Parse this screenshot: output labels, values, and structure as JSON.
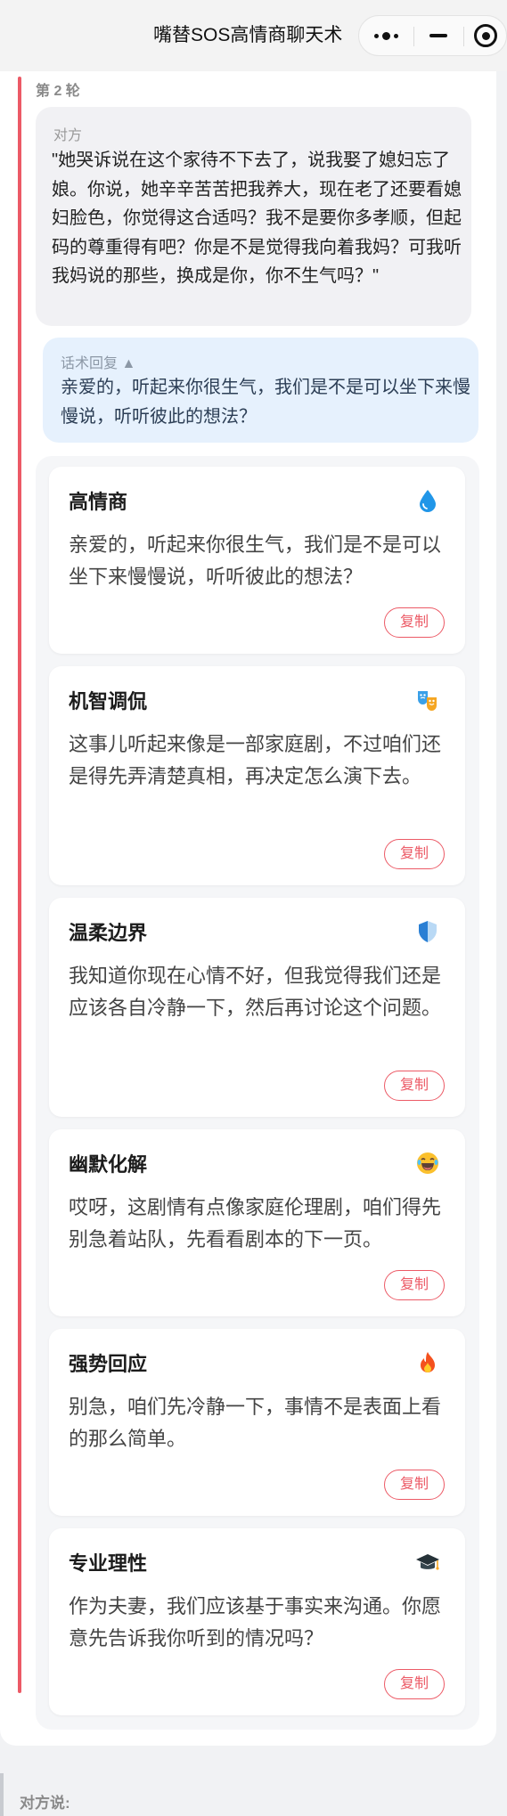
{
  "header": {
    "title": "嘴替SOS高情商聊天术"
  },
  "round": {
    "label": "第 2 轮",
    "opponent": {
      "label": "对方",
      "text": "\"她哭诉说在这个家待不下去了，说我娶了媳妇忘了娘。你说，她辛辛苦苦把我养大，现在老了还要看媳妇脸色，你觉得这合适吗？我不是要你多孝顺，但起码的尊重得有吧？你是不是觉得我向着我妈？可我听我妈说的那些，换成是你，你不生气吗？\""
    },
    "reply": {
      "label": "话术回复 ▲",
      "text": "亲爱的，听起来你很生气，我们是不是可以坐下来慢慢说，听听彼此的想法？"
    },
    "options": [
      {
        "title": "高情商",
        "icon": "droplet-icon",
        "text": "亲爱的，听起来你很生气，我们是不是可以坐下来慢慢说，听听彼此的想法？",
        "copy_label": "复制"
      },
      {
        "title": "机智调侃",
        "icon": "theater-masks-icon",
        "text": "这事儿听起来像是一部家庭剧，不过咱们还是得先弄清楚真相，再决定怎么演下去。",
        "copy_label": "复制"
      },
      {
        "title": "温柔边界",
        "icon": "shield-icon",
        "text": "我知道你现在心情不好，但我觉得我们还是应该各自冷静一下，然后再讨论这个问题。",
        "copy_label": "复制"
      },
      {
        "title": "幽默化解",
        "icon": "laughing-emoji-icon",
        "text": "哎呀，这剧情有点像家庭伦理剧，咱们得先别急着站队，先看看剧本的下一页。",
        "copy_label": "复制"
      },
      {
        "title": "强势回应",
        "icon": "fire-icon",
        "text": "别急，咱们先冷静一下，事情不是表面上看的那么简单。",
        "copy_label": "复制"
      },
      {
        "title": "专业理性",
        "icon": "graduation-cap-icon",
        "text": "作为夫妻，我们应该基于事实来沟通。你愿意先告诉我你听到的情况吗？",
        "copy_label": "复制"
      }
    ]
  },
  "next_round": {
    "label": "对方说:"
  },
  "colors": {
    "accent": "#ec5a66",
    "reply_bg": "#e6f1fd",
    "opponent_bg": "#f1f1f4"
  }
}
